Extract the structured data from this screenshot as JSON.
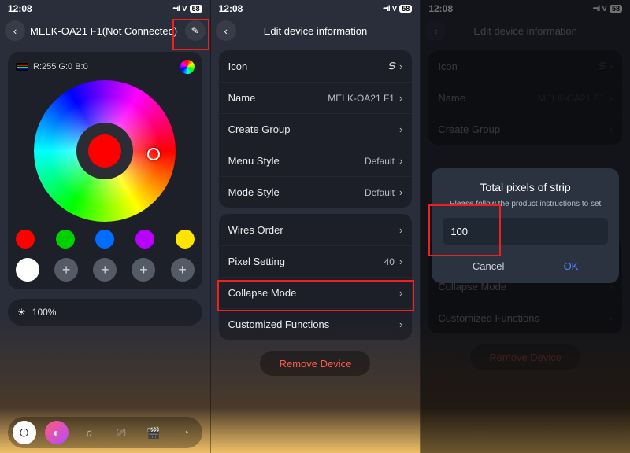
{
  "status": {
    "time": "12:08",
    "battery": "58"
  },
  "screen1": {
    "title": "MELK-OA21 F1(Not Connected)",
    "rgb_readout": "R:255 G:0 B:0",
    "swatches": [
      "#ff0000",
      "#00d000",
      "#006dff",
      "#b800ff",
      "#ffe400"
    ],
    "brightness": "100%"
  },
  "screen2": {
    "title": "Edit device information",
    "group1": [
      {
        "label": "Icon",
        "value": ""
      },
      {
        "label": "Name",
        "value": "MELK-OA21 F1"
      },
      {
        "label": "Create Group",
        "value": ""
      },
      {
        "label": "Menu Style",
        "value": "Default"
      },
      {
        "label": "Mode Style",
        "value": "Default"
      }
    ],
    "group2": [
      {
        "label": "Wires Order",
        "value": ""
      },
      {
        "label": "Pixel Setting",
        "value": "40"
      },
      {
        "label": "Collapse Mode",
        "value": ""
      },
      {
        "label": "Customized Functions",
        "value": ""
      }
    ],
    "remove": "Remove Device"
  },
  "screen3": {
    "title": "Edit device information",
    "dialog": {
      "title": "Total pixels of strip",
      "subtitle": "Please follow the product instructions to set",
      "value": "100",
      "cancel": "Cancel",
      "ok": "OK"
    }
  }
}
